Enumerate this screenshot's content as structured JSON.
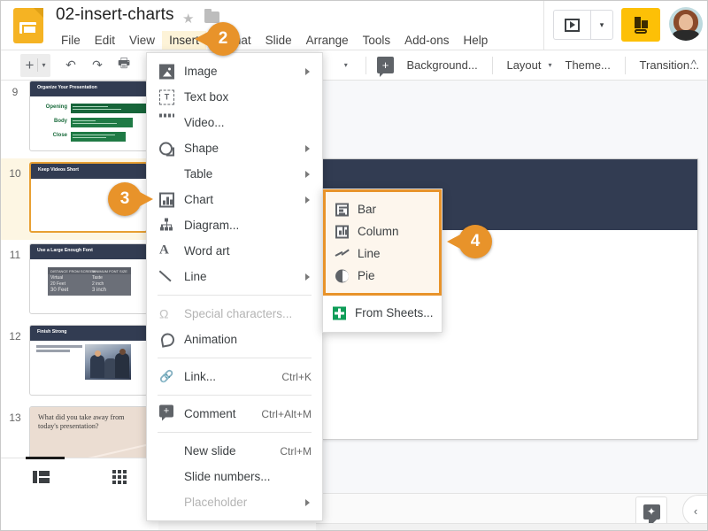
{
  "app": {
    "doc_title": "02-insert-charts",
    "logo_icon": "slides-logo-icon",
    "star_icon": "★",
    "folder_icon": "folder-icon"
  },
  "menubar": [
    {
      "label": "File",
      "active": false
    },
    {
      "label": "Edit",
      "active": false
    },
    {
      "label": "View",
      "active": false
    },
    {
      "label": "Insert",
      "active": true
    },
    {
      "label": "Format",
      "active": false
    },
    {
      "label": "Slide",
      "active": false
    },
    {
      "label": "Arrange",
      "active": false
    },
    {
      "label": "Tools",
      "active": false
    },
    {
      "label": "Add-ons",
      "active": false
    },
    {
      "label": "Help",
      "active": false
    }
  ],
  "topbar_right": {
    "present_icon": "present-play-icon",
    "present_caret": "▾",
    "share_icon": "share-keyboard-icon",
    "avatar": "user-avatar"
  },
  "toolbar": {
    "new_slide_plus": "+",
    "new_slide_caret": "▾",
    "undo_icon": "↶",
    "redo_icon": "↷",
    "print_icon": "🖶",
    "paint_icon": "paint-format-icon",
    "zoom_caret": "▾",
    "comment_plus": "+",
    "background_label": "Background...",
    "layout_label": "Layout",
    "layout_caret": "▾",
    "theme_label": "Theme...",
    "transition_label": "Transition...",
    "collapse_icon": "^"
  },
  "filmstrip": {
    "slides": [
      {
        "num": "9",
        "title": "Organize Your Presentation",
        "selected": false,
        "rows": [
          {
            "label": "Opening"
          },
          {
            "label": "Body"
          },
          {
            "label": "Close"
          }
        ]
      },
      {
        "num": "10",
        "title": "Keep Videos Short",
        "selected": true
      },
      {
        "num": "11",
        "title": "Use a Large Enough Font",
        "selected": false,
        "table": {
          "headers": [
            "DISTANCE FROM SCREEN",
            "MINIMUM FONT SIZE"
          ],
          "rows": [
            [
              "Virtual",
              "Taste"
            ],
            [
              "20 Feet",
              "2 inch"
            ],
            [
              "30 Feet",
              "3 inch"
            ]
          ]
        }
      },
      {
        "num": "12",
        "title": "Finish Strong",
        "selected": false
      },
      {
        "num": "13",
        "title": "",
        "selected": false,
        "question": "What did you take away from today's presentation?"
      }
    ],
    "view_filmstrip_icon": "filmstrip-view-icon",
    "view_grid_icon": "grid-view-icon"
  },
  "insert_menu": {
    "items": [
      {
        "label": "Image",
        "icon": "image-icon",
        "arrow": true,
        "shortcut": "",
        "disabled": false
      },
      {
        "label": "Text box",
        "icon": "textbox-icon",
        "arrow": false,
        "shortcut": "",
        "disabled": false
      },
      {
        "label": "Video...",
        "icon": "video-icon",
        "arrow": false,
        "shortcut": "",
        "disabled": false
      },
      {
        "label": "Shape",
        "icon": "shape-icon",
        "arrow": true,
        "shortcut": "",
        "disabled": false
      },
      {
        "label": "Table",
        "icon": "table-icon",
        "arrow": true,
        "shortcut": "",
        "disabled": false
      },
      {
        "label": "Chart",
        "icon": "chart-icon",
        "arrow": true,
        "shortcut": "",
        "disabled": false
      },
      {
        "label": "Diagram...",
        "icon": "diagram-icon",
        "arrow": false,
        "shortcut": "",
        "disabled": false
      },
      {
        "label": "Word art",
        "icon": "wordart-icon",
        "arrow": false,
        "shortcut": "",
        "disabled": false
      },
      {
        "label": "Line",
        "icon": "line-icon",
        "arrow": true,
        "shortcut": "",
        "disabled": false
      },
      {
        "label": "Special characters...",
        "icon": "omega-icon",
        "arrow": false,
        "shortcut": "",
        "disabled": true
      },
      {
        "label": "Animation",
        "icon": "animation-icon",
        "arrow": false,
        "shortcut": "",
        "disabled": false
      },
      {
        "label": "Link...",
        "icon": "link-icon",
        "arrow": false,
        "shortcut": "Ctrl+K",
        "disabled": false
      },
      {
        "label": "Comment",
        "icon": "comment-icon",
        "arrow": false,
        "shortcut": "Ctrl+Alt+M",
        "disabled": false
      },
      {
        "label": "New slide",
        "icon": "",
        "arrow": false,
        "shortcut": "Ctrl+M",
        "disabled": false
      },
      {
        "label": "Slide numbers...",
        "icon": "",
        "arrow": false,
        "shortcut": "",
        "disabled": false
      },
      {
        "label": "Placeholder",
        "icon": "",
        "arrow": true,
        "shortcut": "",
        "disabled": true
      }
    ]
  },
  "chart_submenu": {
    "highlighted_items": [
      {
        "label": "Bar",
        "icon": "bar-chart-icon"
      },
      {
        "label": "Column",
        "icon": "column-chart-icon"
      },
      {
        "label": "Line",
        "icon": "line-chart-icon"
      },
      {
        "label": "Pie",
        "icon": "pie-chart-icon"
      }
    ],
    "footer_item": {
      "label": "From Sheets...",
      "icon": "google-sheets-icon"
    }
  },
  "callouts": [
    {
      "number": "2"
    },
    {
      "number": "3"
    },
    {
      "number": "4"
    }
  ],
  "canvas": {
    "explore_icon": "explore-icon",
    "collapse_icon": "‹",
    "dots": "• • •"
  },
  "colors": {
    "accent_orange": "#e8932a",
    "slide_navy": "#323c52",
    "brand_yellow": "#fdc006",
    "highlight_yellow": "#fdf3d8",
    "sheets_green": "#0f9d58"
  }
}
